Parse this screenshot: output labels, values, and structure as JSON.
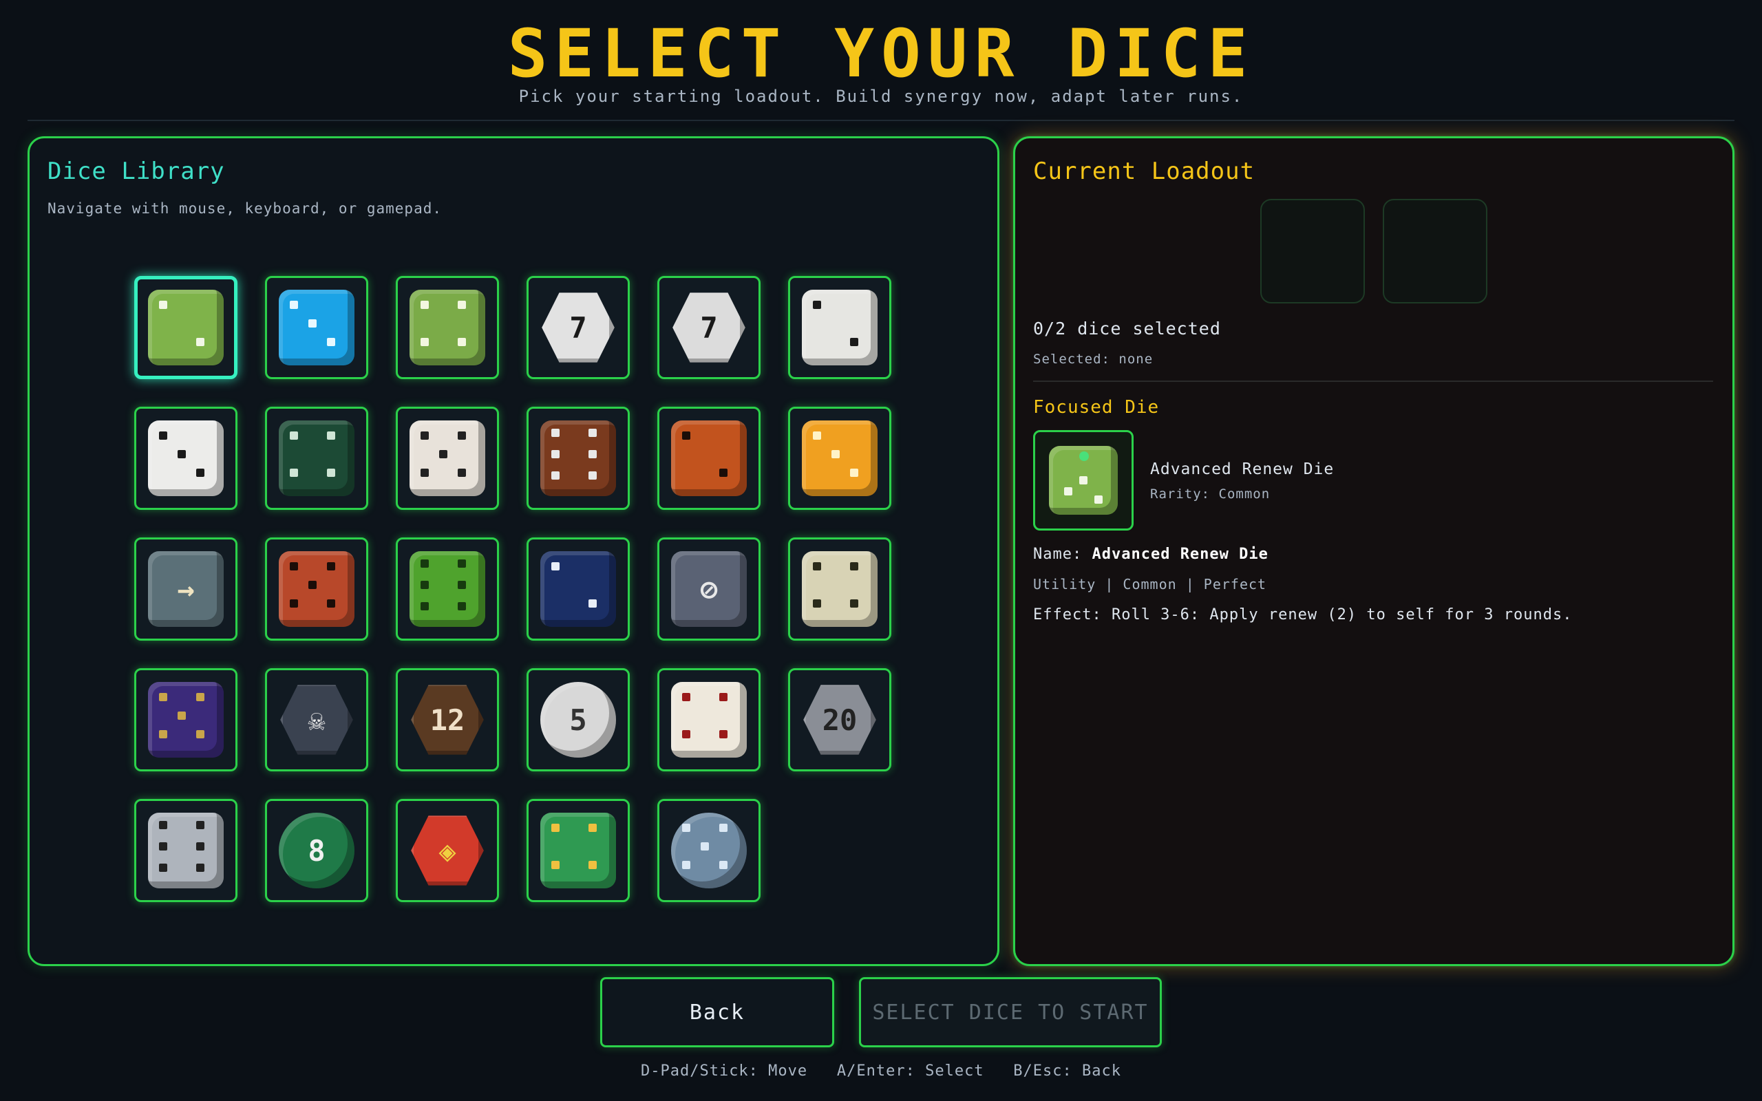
{
  "header": {
    "title": "SELECT YOUR DICE",
    "subtitle": "Pick your starting loadout. Build synergy now, adapt later runs."
  },
  "library": {
    "title": "Dice Library",
    "hint": "Navigate with mouse, keyboard, or gamepad.",
    "dice": [
      {
        "icon": "green-leaf-dice-icon",
        "color": "#7fb34a",
        "pip": "#f1f7e6",
        "shape": "cube",
        "focused": true
      },
      {
        "icon": "blue-flame-dice-icon",
        "color": "#1ba3e6",
        "pip": "#e8f8ff",
        "shape": "cube"
      },
      {
        "icon": "golden-leaf-dice-icon",
        "color": "#7bab48",
        "pip": "#f3f7e0",
        "shape": "cube"
      },
      {
        "icon": "d12-white-dice-icon",
        "color": "#e2e2e2",
        "pip": "#1a1a1a",
        "shape": "hex",
        "num": "7"
      },
      {
        "icon": "d12-white-dice-icon-2",
        "color": "#dcdcdc",
        "pip": "#1a1a1a",
        "shape": "hex",
        "num": "7"
      },
      {
        "icon": "plain-white-dice-icon",
        "color": "#e6e6e2",
        "pip": "#1a1a1a",
        "shape": "cube"
      },
      {
        "icon": "white-dice-icon",
        "color": "#ececea",
        "pip": "#1a1a1a",
        "shape": "cube"
      },
      {
        "icon": "dark-green-dice-icon",
        "color": "#1c4a35",
        "pip": "#cfe5d6",
        "shape": "cube"
      },
      {
        "icon": "bloody-dice-icon",
        "color": "#e8e2da",
        "pip": "#222",
        "shape": "cube"
      },
      {
        "icon": "rusty-dice-icon",
        "color": "#7a3a1e",
        "pip": "#e8e8e8",
        "shape": "cube"
      },
      {
        "icon": "fire-dice-icon",
        "color": "#c2531e",
        "pip": "#1b0d08",
        "shape": "cube"
      },
      {
        "icon": "halo-gold-dice-icon",
        "color": "#f0a020",
        "pip": "#fff3c8",
        "shape": "cube"
      },
      {
        "icon": "arrow-stone-dice-icon",
        "color": "#5b7078",
        "pip": "#efe3c0",
        "shape": "cube",
        "glyph": "→"
      },
      {
        "icon": "sword-dice-icon",
        "color": "#b8482a",
        "pip": "#1b0d08",
        "shape": "cube"
      },
      {
        "icon": "moss-dice-icon",
        "color": "#4fa32d",
        "pip": "#173a0f",
        "shape": "cube"
      },
      {
        "icon": "shield-dice-icon",
        "color": "#1b2f66",
        "pip": "#e8eef8",
        "shape": "cube"
      },
      {
        "icon": "null-dice-icon",
        "color": "#5a6274",
        "pip": "#e8e8e8",
        "shape": "cube",
        "glyph": "⊘"
      },
      {
        "icon": "vine-dice-icon",
        "color": "#d8d3b5",
        "pip": "#2a2a1a",
        "shape": "cube"
      },
      {
        "icon": "purple-hourglass-dice-icon",
        "color": "#3b2a7a",
        "pip": "#c9a54a",
        "shape": "cube"
      },
      {
        "icon": "skull-dice-icon",
        "color": "#3a4250",
        "pip": "#e8e8e8",
        "shape": "hex",
        "num": "☠"
      },
      {
        "icon": "mushroom-d12-dice-icon",
        "color": "#5a3a22",
        "pip": "#f0e0c8",
        "shape": "hex",
        "num": "12"
      },
      {
        "icon": "winged-dice-icon",
        "color": "#d8d8d8",
        "pip": "#333",
        "shape": "round",
        "num": "5"
      },
      {
        "icon": "chained-dice-icon",
        "color": "#eee8dc",
        "pip": "#9a1a1a",
        "shape": "cube"
      },
      {
        "icon": "d20-grey-dice-icon",
        "color": "#8a8e96",
        "pip": "#222",
        "shape": "hex",
        "num": "20"
      },
      {
        "icon": "steel-dice-icon",
        "color": "#aeb4bc",
        "pip": "#222",
        "shape": "cube"
      },
      {
        "icon": "d12-green-dice-icon",
        "color": "#1f7a48",
        "pip": "#f0f0f0",
        "shape": "round",
        "num": "8"
      },
      {
        "icon": "rainbow-d12-dice-icon",
        "color": "#d23a2a",
        "pip": "#f0d040",
        "shape": "hex",
        "num": "◈"
      },
      {
        "icon": "emerald-gold-dice-icon",
        "color": "#2f9a52",
        "pip": "#f0c040",
        "shape": "cube"
      },
      {
        "icon": "disco-ball-dice-icon",
        "color": "#6f8ba4",
        "pip": "#dbe8f4",
        "shape": "round"
      }
    ]
  },
  "loadout": {
    "title": "Current Loadout",
    "count": "0/2 dice selected",
    "selected": "Selected: none",
    "focused_title": "Focused Die",
    "focused_name_small": "Advanced Renew Die",
    "focused_rarity": "Rarity: Common",
    "name_label": "Name:",
    "name_value": "Advanced Renew Die",
    "tags": "Utility | Common | Perfect",
    "effect": "Effect: Roll 3-6: Apply renew (2) to self for 3 rounds."
  },
  "buttons": {
    "back": "Back",
    "start": "SELECT DICE TO START"
  },
  "footer": "D-Pad/Stick: Move   A/Enter: Select   B/Esc: Back",
  "colors": {
    "accent": "#f5c518",
    "border": "#2bd14a",
    "teal": "#3fe0c8"
  }
}
